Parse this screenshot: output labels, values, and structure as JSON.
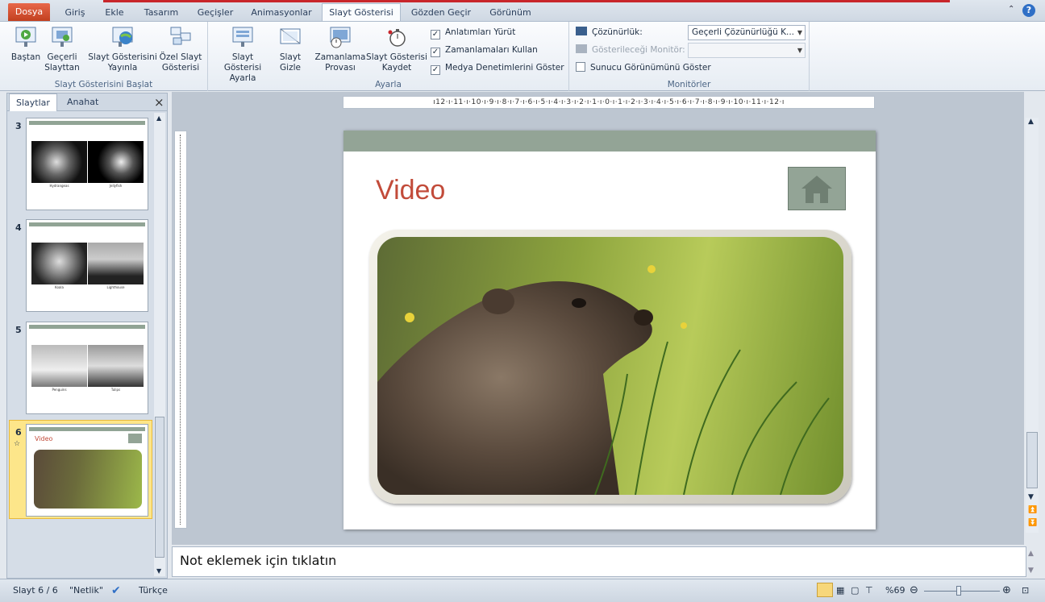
{
  "ribbon_tabs": [
    "Dosya",
    "Giriş",
    "Ekle",
    "Tasarım",
    "Geçişler",
    "Animasyonlar",
    "Slayt Gösterisi",
    "Gözden Geçir",
    "Görünüm"
  ],
  "active_tab": "Slayt Gösterisi",
  "groups": {
    "start": {
      "label": "Slayt Gösterisini Başlat",
      "buttons": [
        "Baştan",
        "Geçerli Slayttan",
        "Slayt Gösterisini Yayınla",
        "Özel Slayt Gösterisi"
      ]
    },
    "setup": {
      "label": "Ayarla",
      "buttons": [
        "Slayt Gösterisi Ayarla",
        "Slayt Gizle",
        "Zamanlama Provası",
        "Slayt Gösterisi Kaydet"
      ],
      "checkboxes": [
        {
          "label": "Anlatımları Yürüt",
          "checked": true
        },
        {
          "label": "Zamanlamaları Kullan",
          "checked": true
        },
        {
          "label": "Medya Denetimlerini Göster",
          "checked": true
        }
      ]
    },
    "monitors": {
      "label": "Monitörler",
      "resolution_label": "Çözünürlük:",
      "resolution_value": "Geçerli Çözünürlüğü K...",
      "show_on_label": "Gösterileceği Monitör:",
      "show_on_value": "",
      "presenter_view": {
        "label": "Sunucu Görünümünü Göster",
        "checked": false
      }
    }
  },
  "pane": {
    "tabs": [
      "Slaytlar",
      "Anahat"
    ],
    "close": "×",
    "slides": [
      {
        "num": "3",
        "captions": [
          "Hydrangeas",
          "Jellyfish"
        ]
      },
      {
        "num": "4",
        "captions": [
          "Koala",
          "Lighthouse"
        ]
      },
      {
        "num": "5",
        "captions": [
          "Penguins",
          "Tulips"
        ]
      },
      {
        "num": "6",
        "title": "Video"
      }
    ]
  },
  "ruler_h": "ı12·ı·11·ı·10·ı·9·ı·8·ı·7·ı·6·ı·5·ı·4·ı·3·ı·2·ı·1·ı·0·ı·1·ı·2·ı·3·ı·4·ı·5·ı·6·ı·7·ı·8·ı·9·ı·10·ı·11·ı·12·ı",
  "slide": {
    "title": "Video"
  },
  "notes_placeholder": "Not eklemek için tıklatın",
  "status": {
    "slide": "Slayt 6 / 6",
    "theme": "\"Netlik\"",
    "language": "Türkçe",
    "zoom": "%69",
    "zoom_level": 0.45
  },
  "colors": {
    "accent": "#c24b3a",
    "bar": "#93a496",
    "file_tab": "#d9502f",
    "selected": "#fde68a"
  }
}
